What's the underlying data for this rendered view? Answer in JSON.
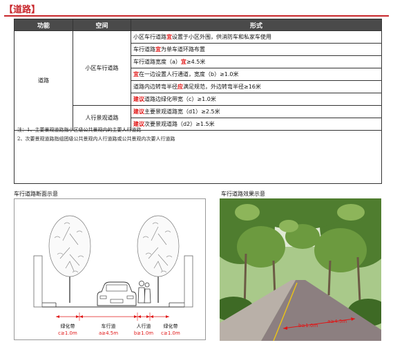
{
  "section_title": "【道路】",
  "table": {
    "headers": [
      "功能",
      "空间",
      "形式"
    ],
    "function": "道路",
    "spaces": [
      "小区车行道路",
      "人行景观道路"
    ],
    "rows": [
      {
        "prefix": "小区车行道路",
        "key": "宜",
        "rest": "设置于小区外围，供消防车和私家车使用"
      },
      {
        "prefix": "车行道路",
        "key": "宜",
        "rest": "为单车道环路布置"
      },
      {
        "prefix": "车行道路宽度（a）",
        "key": "宜",
        "rest": "≥4.5米"
      },
      {
        "prefix": "",
        "key": "宜",
        "rest": "在一边设置人行通道，宽度（b）≥1.0米"
      },
      {
        "prefix": "道路内边转弯半径",
        "key": "应",
        "rest": "满足规范，外边转弯半径≥16米"
      },
      {
        "prefix": "",
        "key": "建议",
        "rest": "道路边绿化带宽（c）≥1.0米"
      },
      {
        "prefix": "",
        "key": "建议",
        "rest": "主要景观道路宽（d1）≥2.5米"
      },
      {
        "prefix": "",
        "key": "建议",
        "rest": "次要景观道路（d2）≥1.5米"
      }
    ]
  },
  "notes": [
    "注：1、主要景观道路指小区级公共景观内的主要人行道路",
    "    2、次要景观道路指组团级公共景观内人行道路或公共景观内次要人行道路"
  ],
  "captions": {
    "section": "车行道路断面示意",
    "photo": "车行道路效果示意"
  },
  "diagram": {
    "zones": [
      {
        "name": "绿化带",
        "dim": "c≥1.0m"
      },
      {
        "name": "车行道",
        "dim": "a≥4.5m"
      },
      {
        "name": "人行道",
        "dim": "b≥1.0m"
      },
      {
        "name": "绿化带",
        "dim": "c≥1.0m"
      }
    ]
  },
  "photo_labels": {
    "left": "b≥1.0m",
    "right": "a≥4.5m"
  },
  "colors": {
    "accent": "#c8262b",
    "header_bg": "#4a4a4a",
    "keyword": "#e01515"
  }
}
